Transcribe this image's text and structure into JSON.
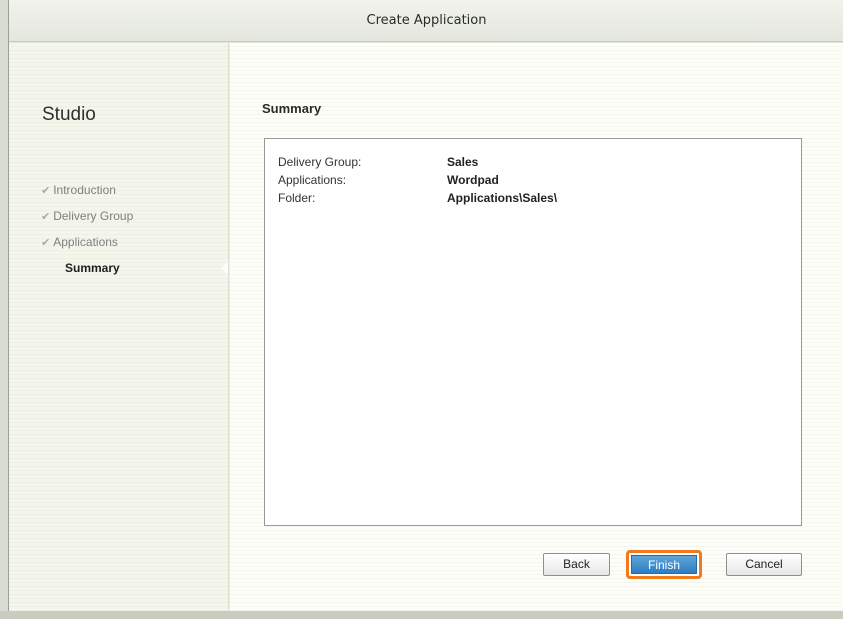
{
  "window": {
    "title": "Create Application"
  },
  "sidebar": {
    "app_name": "Studio",
    "steps": [
      {
        "label": "Introduction",
        "status": "done"
      },
      {
        "label": "Delivery Group",
        "status": "done"
      },
      {
        "label": "Applications",
        "status": "done"
      },
      {
        "label": "Summary",
        "status": "current"
      }
    ],
    "check_glyph": "✔"
  },
  "main": {
    "section_title": "Summary",
    "summary": [
      {
        "label": "Delivery Group:",
        "value": "Sales"
      },
      {
        "label": "Applications:",
        "value": "Wordpad"
      },
      {
        "label": "Folder:",
        "value": "Applications\\Sales\\"
      }
    ]
  },
  "buttons": {
    "back": "Back",
    "finish": "Finish",
    "cancel": "Cancel"
  },
  "colors": {
    "highlight": "#f07a1c",
    "primary": "#2f7ec1"
  }
}
